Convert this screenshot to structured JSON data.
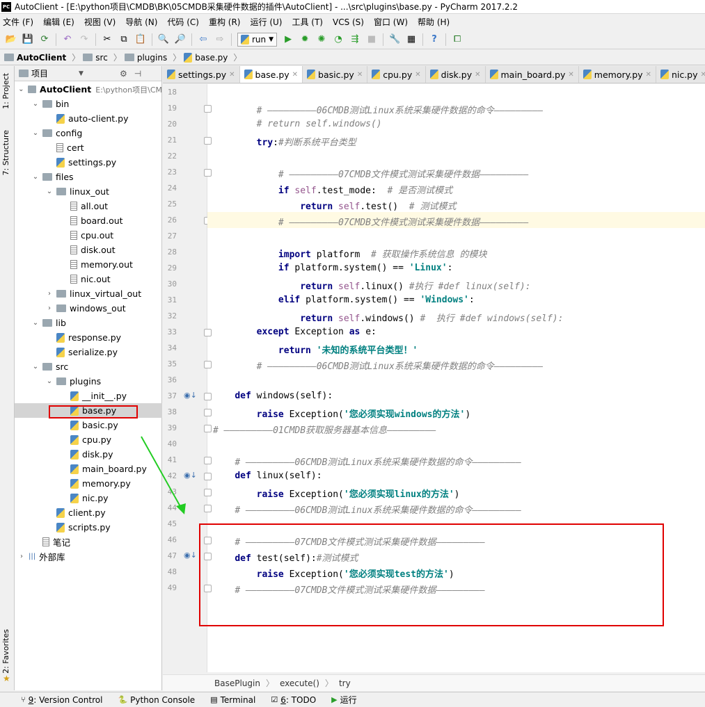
{
  "titlebar": {
    "logo_text": "PC",
    "title": "AutoClient - [E:\\python项目\\CMDB\\BK\\05CMDB采集硬件数据的插件\\AutoClient] - ...\\src\\plugins\\base.py - PyCharm 2017.2.2"
  },
  "menubar": {
    "items": [
      "文件 (F)",
      "编辑 (E)",
      "视图 (V)",
      "导航 (N)",
      "代码 (C)",
      "重构 (R)",
      "运行 (U)",
      "工具 (T)",
      "VCS (S)",
      "窗口 (W)",
      "帮助 (H)"
    ]
  },
  "toolbar": {
    "run_config": "run"
  },
  "navbar": {
    "crumbs": [
      "AutoClient",
      "src",
      "plugins",
      "base.py"
    ]
  },
  "sidebar_tabs": {
    "project": "1: Project",
    "structure": "7: Structure",
    "favorites": "2: Favorites"
  },
  "project_panel": {
    "title": "项目",
    "tree": [
      {
        "label": "AutoClient",
        "suffix": "E:\\python项目\\CM",
        "depth": 0,
        "kind": "folder",
        "expanded": true
      },
      {
        "label": "bin",
        "depth": 1,
        "kind": "folder",
        "expanded": true
      },
      {
        "label": "auto-client.py",
        "depth": 2,
        "kind": "py"
      },
      {
        "label": "config",
        "depth": 1,
        "kind": "folder",
        "expanded": true
      },
      {
        "label": "cert",
        "depth": 2,
        "kind": "file"
      },
      {
        "label": "settings.py",
        "depth": 2,
        "kind": "py"
      },
      {
        "label": "files",
        "depth": 1,
        "kind": "folder",
        "expanded": true
      },
      {
        "label": "linux_out",
        "depth": 2,
        "kind": "folder",
        "expanded": true
      },
      {
        "label": "all.out",
        "depth": 3,
        "kind": "file"
      },
      {
        "label": "board.out",
        "depth": 3,
        "kind": "file"
      },
      {
        "label": "cpu.out",
        "depth": 3,
        "kind": "file"
      },
      {
        "label": "disk.out",
        "depth": 3,
        "kind": "file"
      },
      {
        "label": "memory.out",
        "depth": 3,
        "kind": "file"
      },
      {
        "label": "nic.out",
        "depth": 3,
        "kind": "file"
      },
      {
        "label": "linux_virtual_out",
        "depth": 2,
        "kind": "folder",
        "expanded": false
      },
      {
        "label": "windows_out",
        "depth": 2,
        "kind": "folder",
        "expanded": false
      },
      {
        "label": "lib",
        "depth": 1,
        "kind": "folder",
        "expanded": true
      },
      {
        "label": "response.py",
        "depth": 2,
        "kind": "py"
      },
      {
        "label": "serialize.py",
        "depth": 2,
        "kind": "py"
      },
      {
        "label": "src",
        "depth": 1,
        "kind": "folder",
        "expanded": true
      },
      {
        "label": "plugins",
        "depth": 2,
        "kind": "folder",
        "expanded": true
      },
      {
        "label": "__init__.py",
        "depth": 3,
        "kind": "py"
      },
      {
        "label": "base.py",
        "depth": 3,
        "kind": "py",
        "selected": true
      },
      {
        "label": "basic.py",
        "depth": 3,
        "kind": "py"
      },
      {
        "label": "cpu.py",
        "depth": 3,
        "kind": "py"
      },
      {
        "label": "disk.py",
        "depth": 3,
        "kind": "py"
      },
      {
        "label": "main_board.py",
        "depth": 3,
        "kind": "py"
      },
      {
        "label": "memory.py",
        "depth": 3,
        "kind": "py"
      },
      {
        "label": "nic.py",
        "depth": 3,
        "kind": "py"
      },
      {
        "label": "client.py",
        "depth": 2,
        "kind": "py"
      },
      {
        "label": "scripts.py",
        "depth": 2,
        "kind": "py"
      },
      {
        "label": "笔记",
        "depth": 1,
        "kind": "file"
      },
      {
        "label": "外部库",
        "depth": 0,
        "kind": "lib",
        "expanded": false
      }
    ]
  },
  "tabs": [
    "settings.py",
    "base.py",
    "basic.py",
    "cpu.py",
    "disk.py",
    "main_board.py",
    "memory.py",
    "nic.py"
  ],
  "active_tab": "base.py",
  "editor": {
    "lines": [
      {
        "n": "18",
        "segs": []
      },
      {
        "n": "19",
        "segs": [
          {
            "t": "        "
          },
          {
            "c": "cm",
            "t": "# ―――――――――06CMDB测试Linux系统采集硬件数据的命令―――――――――"
          }
        ]
      },
      {
        "n": "20",
        "segs": [
          {
            "t": "        "
          },
          {
            "c": "cm",
            "t": "# return self.windows()"
          }
        ]
      },
      {
        "n": "21",
        "segs": [
          {
            "t": "        "
          },
          {
            "c": "kw",
            "t": "try"
          },
          {
            "t": ":"
          },
          {
            "c": "cm",
            "t": "#判断系统平台类型"
          }
        ]
      },
      {
        "n": "22",
        "segs": []
      },
      {
        "n": "23",
        "segs": [
          {
            "t": "            "
          },
          {
            "c": "cm",
            "t": "# ―――――――――07CMDB文件模式测试采集硬件数据―――――――――"
          }
        ]
      },
      {
        "n": "24",
        "segs": [
          {
            "t": "            "
          },
          {
            "c": "kw",
            "t": "if "
          },
          {
            "c": "slf",
            "t": "self"
          },
          {
            "t": ".test_mode:  "
          },
          {
            "c": "cm",
            "t": "# 是否测试模式"
          }
        ]
      },
      {
        "n": "25",
        "segs": [
          {
            "t": "                "
          },
          {
            "c": "kw",
            "t": "return "
          },
          {
            "c": "slf",
            "t": "self"
          },
          {
            "t": ".test()  "
          },
          {
            "c": "cm",
            "t": "# 测试模式"
          }
        ]
      },
      {
        "n": "26",
        "segs": [
          {
            "t": "            "
          },
          {
            "c": "cm",
            "t": "# ―――――――――07CMDB文件模式测试采集硬件数据―――――――――"
          }
        ]
      },
      {
        "n": "27",
        "segs": []
      },
      {
        "n": "28",
        "segs": [
          {
            "t": "            "
          },
          {
            "c": "kw",
            "t": "import "
          },
          {
            "t": "platform  "
          },
          {
            "c": "cm",
            "t": "# 获取操作系统信息 的模块"
          }
        ]
      },
      {
        "n": "29",
        "segs": [
          {
            "t": "            "
          },
          {
            "c": "kw",
            "t": "if "
          },
          {
            "t": "platform.system() == "
          },
          {
            "c": "str",
            "t": "'Linux'"
          },
          {
            "t": ":"
          }
        ]
      },
      {
        "n": "30",
        "segs": [
          {
            "t": "                "
          },
          {
            "c": "kw",
            "t": "return "
          },
          {
            "c": "slf",
            "t": "self"
          },
          {
            "t": ".linux() "
          },
          {
            "c": "cm",
            "t": "#执行 #def linux(self):"
          }
        ]
      },
      {
        "n": "31",
        "segs": [
          {
            "t": "            "
          },
          {
            "c": "kw",
            "t": "elif "
          },
          {
            "t": "platform.system() == "
          },
          {
            "c": "str",
            "t": "'Windows'"
          },
          {
            "t": ":"
          }
        ]
      },
      {
        "n": "32",
        "segs": [
          {
            "t": "                "
          },
          {
            "c": "kw",
            "t": "return "
          },
          {
            "c": "slf",
            "t": "self"
          },
          {
            "t": ".windows() "
          },
          {
            "c": "cm",
            "t": "#  执行 #def windows(self):"
          }
        ]
      },
      {
        "n": "33",
        "segs": [
          {
            "t": "        "
          },
          {
            "c": "kw",
            "t": "except "
          },
          {
            "t": "Exception "
          },
          {
            "c": "kw",
            "t": "as "
          },
          {
            "t": "e:"
          }
        ]
      },
      {
        "n": "34",
        "segs": [
          {
            "t": "            "
          },
          {
            "c": "kw",
            "t": "return "
          },
          {
            "c": "str",
            "t": "'未知的系统平台类型！'"
          }
        ]
      },
      {
        "n": "35",
        "segs": [
          {
            "t": "        "
          },
          {
            "c": "cm",
            "t": "# ―――――――――06CMDB测试Linux系统采集硬件数据的命令―――――――――"
          }
        ]
      },
      {
        "n": "36",
        "segs": []
      },
      {
        "n": "37",
        "segs": [
          {
            "t": "    "
          },
          {
            "c": "kw",
            "t": "def "
          },
          {
            "t": "windows(self):"
          }
        ],
        "impl": true
      },
      {
        "n": "38",
        "segs": [
          {
            "t": "        "
          },
          {
            "c": "kw",
            "t": "raise "
          },
          {
            "t": "Exception("
          },
          {
            "c": "str",
            "t": "'您必须实现windows的方法'"
          },
          {
            "t": ")"
          }
        ]
      },
      {
        "n": "39",
        "segs": [
          {
            "c": "cm",
            "t": "# ―――――――――01CMDB获取服务器基本信息―――――――――"
          }
        ]
      },
      {
        "n": "40",
        "segs": []
      },
      {
        "n": "41",
        "segs": [
          {
            "t": "    "
          },
          {
            "c": "cm",
            "t": "# ―――――――――06CMDB测试Linux系统采集硬件数据的命令―――――――――"
          }
        ]
      },
      {
        "n": "42",
        "segs": [
          {
            "t": "    "
          },
          {
            "c": "kw",
            "t": "def "
          },
          {
            "t": "linux(self):"
          }
        ],
        "impl": true
      },
      {
        "n": "43",
        "segs": [
          {
            "t": "        "
          },
          {
            "c": "kw",
            "t": "raise "
          },
          {
            "t": "Exception("
          },
          {
            "c": "str",
            "t": "'您必须实现linux的方法'"
          },
          {
            "t": ")"
          }
        ]
      },
      {
        "n": "44",
        "segs": [
          {
            "t": "    "
          },
          {
            "c": "cm",
            "t": "# ―――――――――06CMDB测试Linux系统采集硬件数据的命令―――――――――"
          }
        ]
      },
      {
        "n": "45",
        "segs": []
      },
      {
        "n": "46",
        "segs": [
          {
            "t": "    "
          },
          {
            "c": "cm",
            "t": "# ―――――――――07CMDB文件模式测试采集硬件数据―――――――――"
          }
        ]
      },
      {
        "n": "47",
        "segs": [
          {
            "t": "    "
          },
          {
            "c": "kw",
            "t": "def "
          },
          {
            "t": "test(self):"
          },
          {
            "c": "cm",
            "t": "#测试模式"
          }
        ],
        "impl": true
      },
      {
        "n": "48",
        "segs": [
          {
            "t": "        "
          },
          {
            "c": "kw",
            "t": "raise "
          },
          {
            "t": "Exception("
          },
          {
            "c": "str",
            "t": "'您必须实现test的方法'"
          },
          {
            "t": ")"
          }
        ]
      },
      {
        "n": "49",
        "segs": [
          {
            "t": "    "
          },
          {
            "c": "cm",
            "t": "# ―――――――――07CMDB文件模式测试采集硬件数据―――――――――"
          }
        ]
      }
    ]
  },
  "code_breadcrumb": [
    "BasePlugin",
    "execute()",
    "try"
  ],
  "bottom_tools": [
    {
      "key": "9",
      "label": ": Version Control"
    },
    {
      "key": "",
      "label": "Python Console"
    },
    {
      "key": "",
      "label": "Terminal"
    },
    {
      "key": "6",
      "label": ": TODO"
    },
    {
      "key": "",
      "label": "运行"
    }
  ],
  "colors": {
    "keyword": "#000080",
    "comment": "#808080",
    "string": "#008080",
    "self": "#94558d",
    "annotation_red": "#e00000",
    "annotation_arrow": "#22cc22"
  }
}
